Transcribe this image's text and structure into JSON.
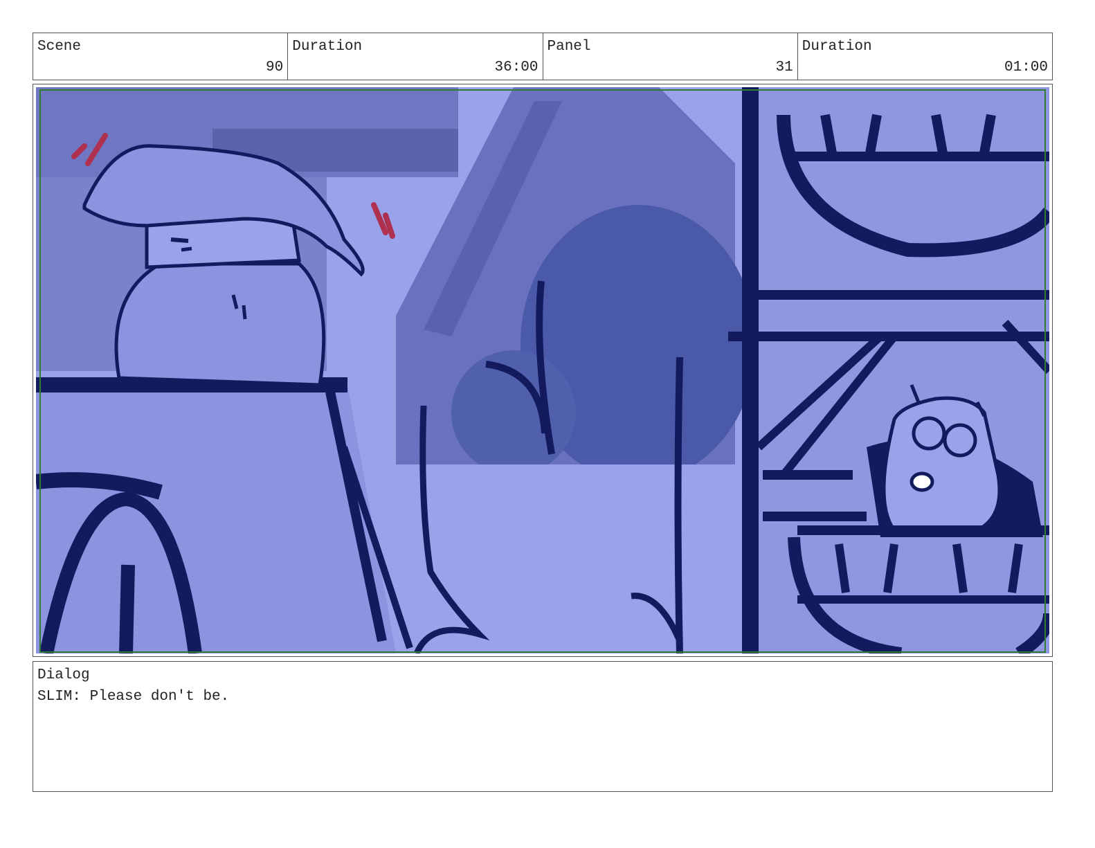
{
  "header": {
    "scene_label": "Scene",
    "scene_value": "90",
    "scene_duration_label": "Duration",
    "scene_duration_value": "36:00",
    "panel_label": "Panel",
    "panel_value": "31",
    "panel_duration_label": "Duration",
    "panel_duration_value": "01:00"
  },
  "dialog": {
    "label": "Dialog",
    "text": "SLIM: Please don't be."
  },
  "colors": {
    "tint_base": "#8f97e0",
    "ink": "#141a5e",
    "safe_area": "#2e7d32",
    "accent_red": "#b03050"
  }
}
